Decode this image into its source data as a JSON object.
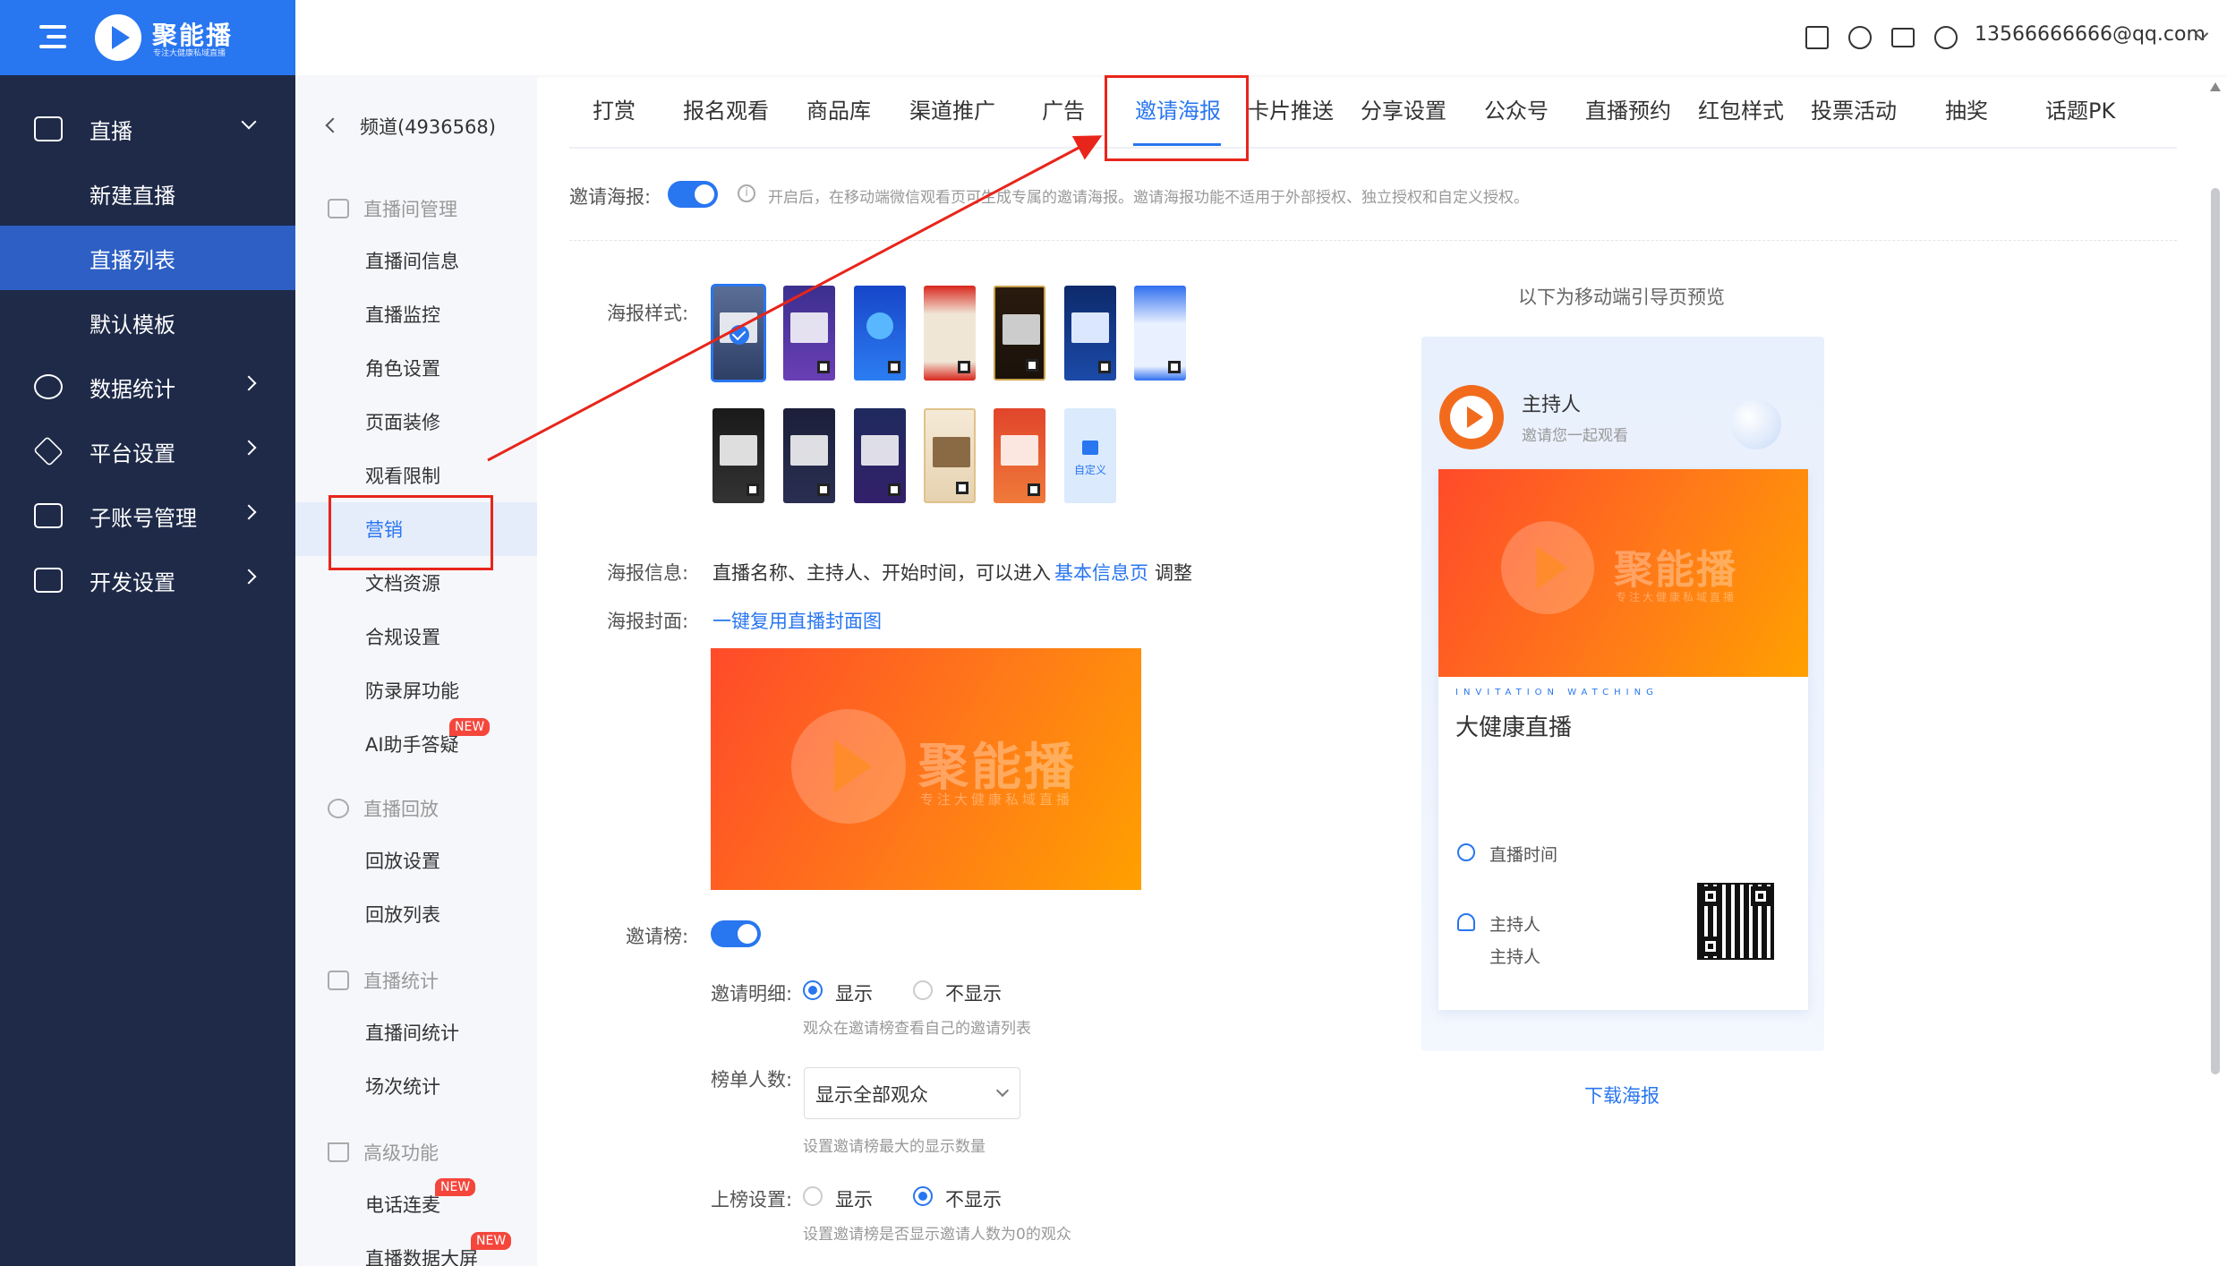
{
  "brand": {
    "name": "聚能播",
    "tagline": "专注大健康私域直播"
  },
  "sidebar": {
    "items": [
      {
        "label": "直播",
        "icon": "video-camera-icon"
      },
      {
        "label": "新建直播"
      },
      {
        "label": "直播列表"
      },
      {
        "label": "默认模板"
      },
      {
        "label": "数据统计",
        "icon": "pie-chart-icon"
      },
      {
        "label": "平台设置",
        "icon": "layers-icon"
      },
      {
        "label": "子账号管理",
        "icon": "id-card-icon"
      },
      {
        "label": "开发设置",
        "icon": "code-icon"
      }
    ]
  },
  "topbar": {
    "email": "13566666666@qq.com",
    "icons": [
      "document-icon",
      "download-icon",
      "mail-icon",
      "yuan-icon"
    ]
  },
  "secmenu": {
    "back": "频道(4936568)",
    "groups": [
      "直播间管理",
      "直播回放",
      "直播统计",
      "高级功能"
    ],
    "items": [
      "直播间信息",
      "直播监控",
      "角色设置",
      "页面装修",
      "观看限制",
      "营销",
      "文档资源",
      "合规设置",
      "防录屏功能",
      "AI助手答疑",
      "回放设置",
      "回放列表",
      "直播间统计",
      "场次统计",
      "电话连麦",
      "直播数据大屏"
    ],
    "badge": "NEW"
  },
  "tabs": [
    "打赏",
    "报名观看",
    "商品库",
    "渠道推广",
    "广告",
    "邀请海报",
    "卡片推送",
    "分享设置",
    "公众号",
    "直播预约",
    "红包样式",
    "投票活动",
    "抽奖",
    "话题PK"
  ],
  "form": {
    "invite_poster_label": "邀请海报:",
    "invite_poster_hint": "开启后，在移动端微信观看页可生成专属的邀请海报。邀请海报功能不适用于外部授权、独立授权和自定义授权。",
    "poster_style_label": "海报样式:",
    "custom_label": "自定义",
    "poster_info_label": "海报信息:",
    "poster_info_text": "直播名称、主持人、开始时间，可以进入",
    "poster_info_link": "基本信息页",
    "poster_info_suffix": "调整",
    "poster_cover_label": "海报封面:",
    "poster_cover_link": "一键复用直播封面图",
    "cover_watermark": "聚能播",
    "cover_watermark_sub": "专注大健康私域直播",
    "invite_rank_label": "邀请榜:",
    "invite_detail_label": "邀请明细:",
    "show": "显示",
    "hide": "不显示",
    "invite_detail_hint": "观众在邀请榜查看自己的邀请列表",
    "rank_count_label": "榜单人数:",
    "rank_count_value": "显示全部观众",
    "rank_count_hint": "设置邀请榜最大的显示数量",
    "rank_setting_label": "上榜设置:",
    "rank_setting_hint": "设置邀请榜是否显示邀请人数为0的观众"
  },
  "preview": {
    "title": "以下为移动端引导页预览",
    "host_name": "主持人",
    "host_sub": "邀请您一起观看",
    "invitation_en": "INVITATION WATCHING",
    "live_title": "大健康直播",
    "time_label": "直播时间",
    "host_label": "主持人",
    "host_value": "主持人",
    "download": "下载海报"
  },
  "colors": {
    "primary": "#2876f0",
    "sidebar": "#1e2a48",
    "highlight_box": "#e8251b"
  }
}
